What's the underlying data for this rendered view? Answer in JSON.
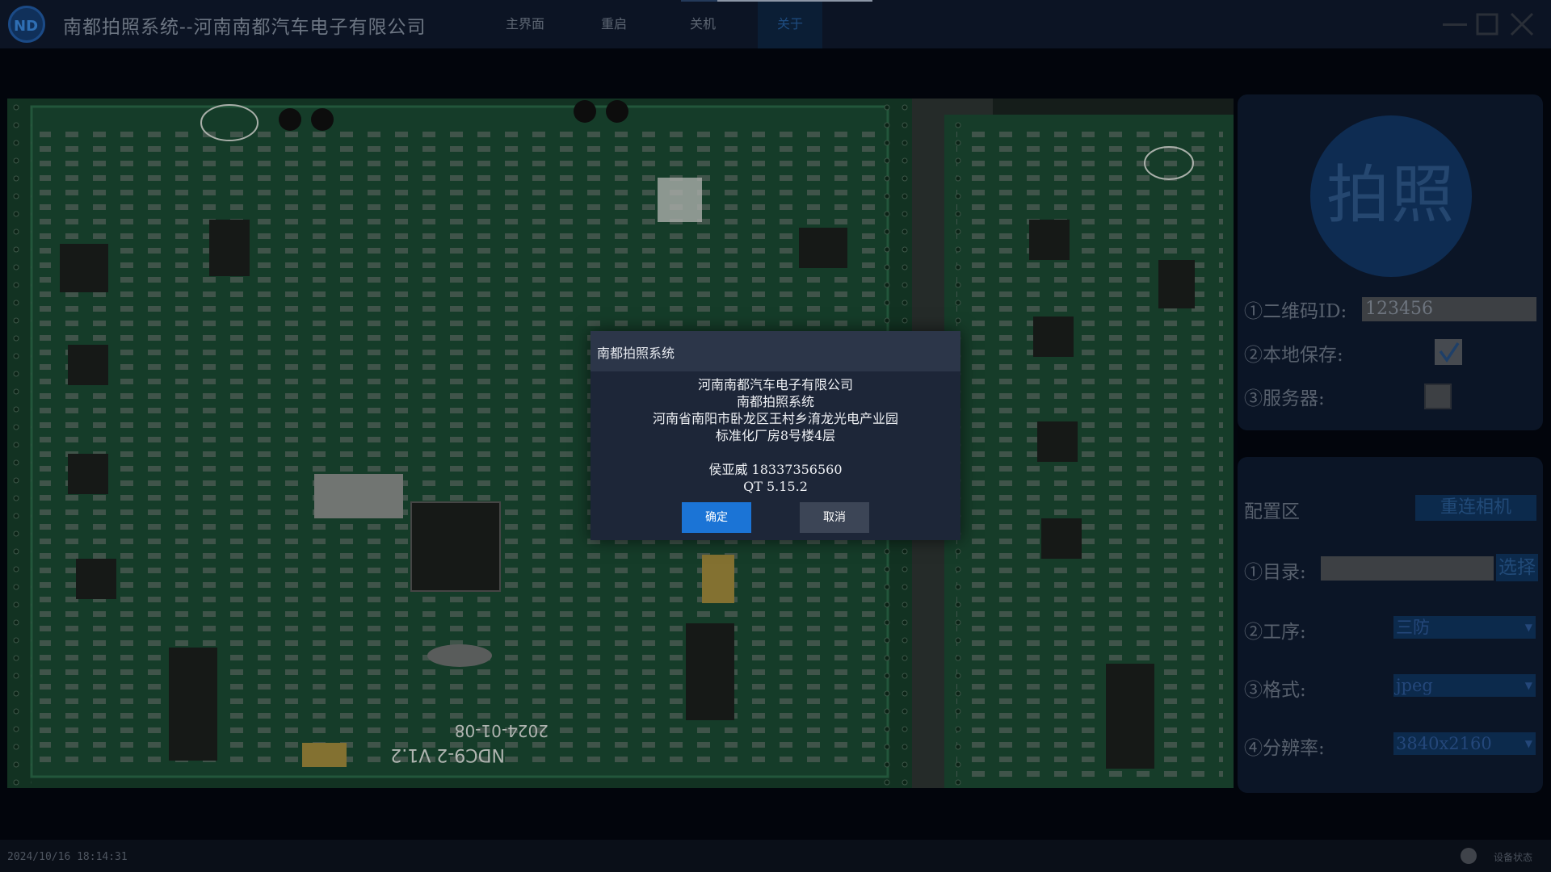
{
  "app": {
    "title": "南都拍照系统--河南南都汽车电子有限公司"
  },
  "nav": {
    "main": "主界面",
    "restart": "重启",
    "shutdown": "关机",
    "about": "关于"
  },
  "capture": {
    "shoot_label": "拍照",
    "qr_label": "①二维码ID:",
    "qr_value": "123456",
    "local_save_label": "②本地保存:",
    "local_save_checked": true,
    "server_label": "③服务器:",
    "server_checked": false
  },
  "config": {
    "title": "配置区",
    "reconnect_label": "重连相机",
    "dir_label": "①目录:",
    "dir_value": "",
    "pick_label": "选择",
    "process_label": "②工序:",
    "process_value": "三防",
    "format_label": "③格式:",
    "format_value": "jpeg",
    "resolution_label": "④分辨率:",
    "resolution_value": "3840x2160"
  },
  "pcb_text": {
    "board_label": "NDC9-2 V1.2",
    "board_date": "2024-01-08"
  },
  "status": {
    "datetime": "2024/10/16 18:14:31",
    "device_label": "设备状态"
  },
  "dialog": {
    "title": "南都拍照系统",
    "line1": "河南南都汽车电子有限公司",
    "line2": "南都拍照系统",
    "line3": "河南省南阳市卧龙区王村乡淯龙光电产业园",
    "line4": "标准化厂房8号楼4层",
    "line5": "侯亚威 18337356560",
    "line6": "QT 5.15.2",
    "ok_label": "确定",
    "cancel_label": "取消"
  },
  "colors": {
    "titlebar_bg": "#0c1424",
    "panel_bg": "#0b1526",
    "accent_blue": "#1b74d6",
    "pcb_green": "#163d2a"
  },
  "icons": {
    "logo": "nd-logo-icon",
    "minimize": "minimize-icon",
    "maximize": "maximize-icon",
    "close": "close-icon",
    "checkmark": "checkmark-icon",
    "dropdown": "chevron-down-icon"
  }
}
